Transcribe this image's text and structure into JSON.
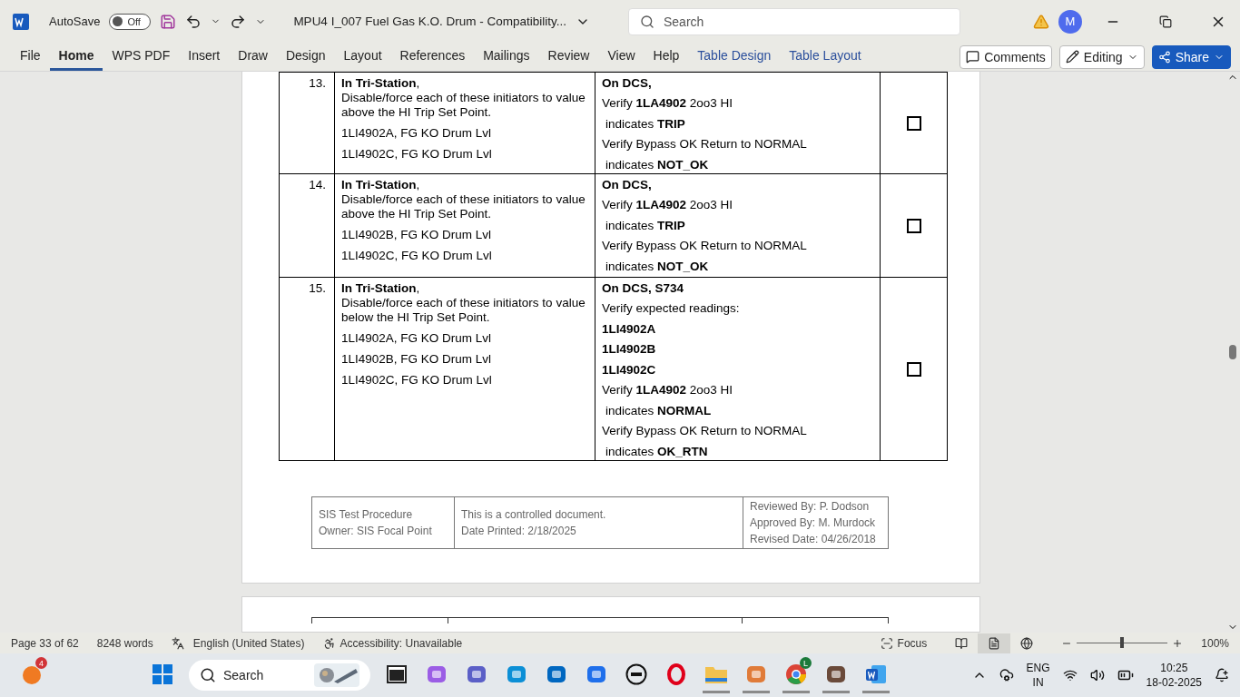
{
  "title_bar": {
    "autosave_label": "AutoSave",
    "autosave": {
      "label": "Off",
      "on": false
    },
    "document_title": "MPU4 I_007 Fuel Gas K.O. Drum  -  Compatibility...",
    "search": {
      "placeholder": "Search"
    },
    "avatar": "M"
  },
  "ribbon_tabs": [
    {
      "label": "File",
      "selected": false,
      "kind": "normal"
    },
    {
      "label": "Home",
      "selected": true,
      "kind": "normal"
    },
    {
      "label": "WPS PDF",
      "selected": false,
      "kind": "normal"
    },
    {
      "label": "Insert",
      "selected": false,
      "kind": "normal"
    },
    {
      "label": "Draw",
      "selected": false,
      "kind": "normal"
    },
    {
      "label": "Design",
      "selected": false,
      "kind": "normal"
    },
    {
      "label": "Layout",
      "selected": false,
      "kind": "normal"
    },
    {
      "label": "References",
      "selected": false,
      "kind": "normal"
    },
    {
      "label": "Mailings",
      "selected": false,
      "kind": "normal"
    },
    {
      "label": "Review",
      "selected": false,
      "kind": "normal"
    },
    {
      "label": "View",
      "selected": false,
      "kind": "normal"
    },
    {
      "label": "Help",
      "selected": false,
      "kind": "normal"
    },
    {
      "label": "Table Design",
      "selected": false,
      "kind": "contextual"
    },
    {
      "label": "Table Layout",
      "selected": false,
      "kind": "contextual"
    }
  ],
  "ribbon_buttons": {
    "comments": "Comments",
    "editing": "Editing",
    "share": "Share"
  },
  "table": {
    "rows": [
      {
        "number": "13.",
        "heading": "**In Tri-Station**,",
        "instruction": "Disable/force each of these initiators to value above the HI Trip Set Point.",
        "initiators": [
          "1LI4902A, FG KO Drum Lvl",
          "1LI4902C, FG KO Drum Lvl"
        ],
        "verify": [
          {
            "text": "**On DCS,**",
            "indent": false
          },
          {
            "text": "Verify **1LA4902** 2oo3 HI",
            "indent": false
          },
          {
            "text": "indicates **TRIP**",
            "indent": true
          },
          {
            "text": "Verify Bypass OK Return to NORMAL",
            "indent": false
          },
          {
            "text": "indicates **NOT_OK**",
            "indent": true
          }
        ],
        "checked": false
      },
      {
        "number": "14.",
        "heading": "**In Tri-Station**,",
        "instruction": "Disable/force each of these initiators to value above the HI Trip Set Point.",
        "initiators": [
          "1LI4902B, FG KO Drum Lvl",
          "1LI4902C, FG KO Drum Lvl"
        ],
        "verify": [
          {
            "text": "**On DCS,**",
            "indent": false
          },
          {
            "text": "Verify **1LA4902** 2oo3 HI",
            "indent": false
          },
          {
            "text": "indicates **TRIP**",
            "indent": true
          },
          {
            "text": "Verify Bypass OK Return to NORMAL",
            "indent": false
          },
          {
            "text": "indicates **NOT_OK**",
            "indent": true
          }
        ],
        "checked": false
      },
      {
        "number": "15.",
        "heading": "**In Tri-Station**,",
        "instruction": "Disable/force each of these initiators to value below the HI Trip Set Point.",
        "initiators": [
          "1LI4902A, FG KO Drum Lvl",
          "1LI4902B, FG KO Drum Lvl",
          "1LI4902C, FG KO Drum Lvl"
        ],
        "verify": [
          {
            "text": "**On DCS, S734**",
            "indent": false
          },
          {
            "text": "Verify expected readings:",
            "indent": false
          },
          {
            "text": "**1LI4902A**",
            "indent": false
          },
          {
            "text": "**1LI4902B**",
            "indent": false
          },
          {
            "text": "**1LI4902C**",
            "indent": false
          },
          {
            "text": "Verify **1LA4902** 2oo3 HI",
            "indent": false
          },
          {
            "text": "indicates **NORMAL**",
            "indent": true
          },
          {
            "text": "Verify Bypass OK Return to NORMAL",
            "indent": false
          },
          {
            "text": "indicates **OK_RTN**",
            "indent": true
          }
        ],
        "checked": false
      }
    ]
  },
  "page_footer": [
    [
      "SIS Test Procedure",
      "Owner: SIS Focal Point"
    ],
    [
      "This is a controlled document.",
      "Date Printed: 2/18/2025"
    ],
    [
      "Reviewed By: P. Dodson",
      "Approved By: M. Murdock",
      "Revised Date: 04/26/2018"
    ]
  ],
  "status_bar": {
    "page": "Page 33 of 62",
    "words": "8248 words",
    "language": "English (United States)",
    "accessibility": "Accessibility: Unavailable",
    "focus": "Focus",
    "views": [
      {
        "kind": "read",
        "selected": false
      },
      {
        "kind": "print",
        "selected": true
      },
      {
        "kind": "web",
        "selected": false
      }
    ],
    "zoom": {
      "level": 0.5,
      "reading": "100%"
    }
  },
  "taskbar": {
    "widget_badge": "4",
    "search": {
      "placeholder": "Search"
    },
    "apps": [
      {
        "kind": "start",
        "running": false
      },
      {
        "kind": "terminal",
        "running": false
      },
      {
        "kind": "copilot",
        "running": false
      },
      {
        "kind": "teams",
        "running": false
      },
      {
        "kind": "edge",
        "running": false
      },
      {
        "kind": "store",
        "running": false
      },
      {
        "kind": "arrow",
        "running": false
      },
      {
        "kind": "dell",
        "running": false
      },
      {
        "kind": "opera",
        "running": false
      },
      {
        "kind": "folder",
        "running": true
      },
      {
        "kind": "fish",
        "running": true
      },
      {
        "kind": "chrome",
        "running": true,
        "badge": "L"
      },
      {
        "kind": "contact",
        "running": true
      },
      {
        "kind": "word",
        "running": true
      }
    ],
    "language": [
      "ENG",
      "IN"
    ],
    "time": "10:25",
    "date": "18-02-2025"
  }
}
